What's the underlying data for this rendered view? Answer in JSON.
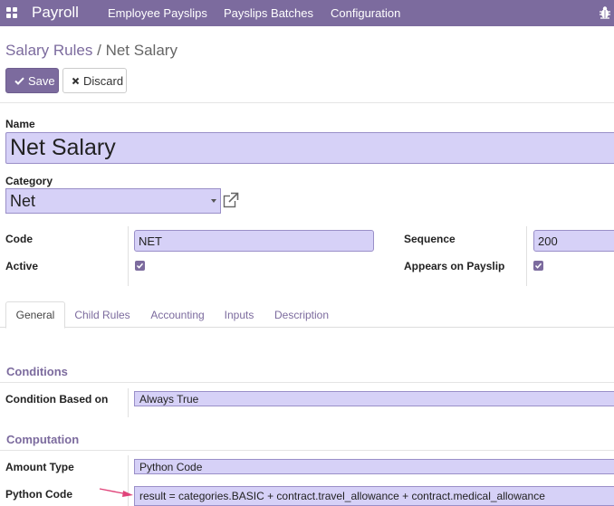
{
  "navbar": {
    "app_title": "Payroll",
    "items": [
      "Employee Payslips",
      "Payslips Batches",
      "Configuration"
    ],
    "apps_icon": "apps-grid-icon",
    "debug_icon": "bug-icon"
  },
  "breadcrumb": {
    "parent": "Salary Rules",
    "separator": "/",
    "current": "Net Salary"
  },
  "buttons": {
    "save": "Save",
    "discard": "Discard"
  },
  "form": {
    "name_label": "Name",
    "name_value": "Net Salary",
    "category_label": "Category",
    "category_value": "Net",
    "code_label": "Code",
    "code_value": "NET",
    "sequence_label": "Sequence",
    "sequence_value": "200",
    "active_label": "Active",
    "active_checked": true,
    "payslip_label": "Appears on Payslip",
    "payslip_checked": true
  },
  "tabs": [
    "General",
    "Child Rules",
    "Accounting",
    "Inputs",
    "Description"
  ],
  "active_tab": "General",
  "conditions": {
    "title": "Conditions",
    "condition_label": "Condition Based on",
    "condition_value": "Always True"
  },
  "computation": {
    "title": "Computation",
    "amount_type_label": "Amount Type",
    "amount_type_value": "Python Code",
    "python_code_label": "Python Code",
    "python_code_value": "result = categories.BASIC + contract.travel_allowance + contract.medical_allowance"
  },
  "colors": {
    "brand": "#7c6b9e",
    "field_bg": "#d6d1f7",
    "annotation_arrow": "#e0447a"
  }
}
